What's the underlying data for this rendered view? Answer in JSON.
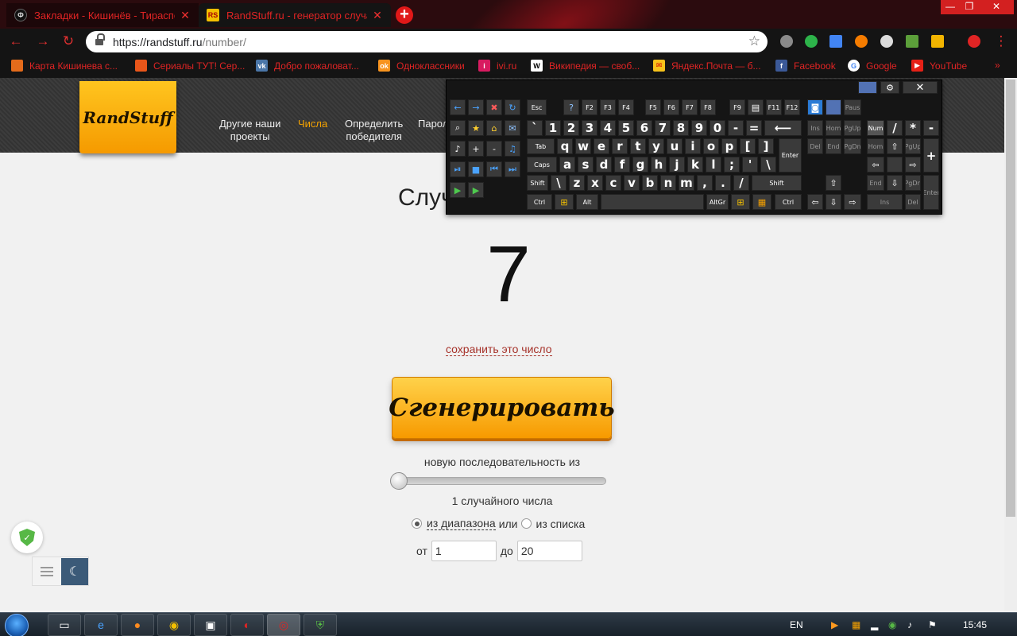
{
  "browser": {
    "tabs": [
      {
        "title": "Закладки - Кишинёв - Тирасполь",
        "active": false
      },
      {
        "title": "RandStuff.ru - генератор случайных чисел",
        "active": true
      }
    ],
    "address": {
      "host": "https://randstuff.ru",
      "path": "/number/"
    },
    "bookmarks": [
      {
        "label": "Карта Кишинева с...",
        "icon": "map-icon",
        "color": "#e36b1b"
      },
      {
        "label": "Сериалы ТУТ! Сер...",
        "icon": "flame-icon",
        "color": "#e9561a"
      },
      {
        "label": "Добро пожаловат...",
        "icon": "vk-icon",
        "color": "#4a76a8"
      },
      {
        "label": "Одноклассники",
        "icon": "ok-icon",
        "color": "#f7931e"
      },
      {
        "label": "ivi.ru",
        "icon": "ivi-icon",
        "color": "#d81b60"
      },
      {
        "label": "Википедия — своб...",
        "icon": "wikipedia-icon",
        "color": "#ffffff"
      },
      {
        "label": "Яндекс.Почта — б...",
        "icon": "mail-icon",
        "color": "#f6c21b"
      },
      {
        "label": "Facebook",
        "icon": "facebook-icon",
        "color": "#3b5998"
      },
      {
        "label": "Google",
        "icon": "google-icon",
        "color": "#ffffff"
      },
      {
        "label": "YouTube",
        "icon": "youtube-icon",
        "color": "#e62117"
      }
    ]
  },
  "site": {
    "logo": "RandStuff",
    "menu": [
      {
        "line1": "Другие наши",
        "line2": "проекты",
        "active": false
      },
      {
        "line1": "Числа",
        "line2": "",
        "active": true
      },
      {
        "line1": "Определить",
        "line2": "победителя",
        "active": false
      },
      {
        "line1": "Пароли",
        "line2": "",
        "active": false
      }
    ],
    "heading": "Случайное число",
    "result": "7",
    "save_link": "сохранить это число",
    "generate_button": "Сгенерировать",
    "sequence_label": "новую последовательность из",
    "slider_value": 1,
    "count_label": "1 случайного числа",
    "mode_range": "из диапазона",
    "mode_or": "или",
    "mode_list": "из списка",
    "from_label": "от",
    "from_value": "1",
    "to_label": "до",
    "to_value": "20"
  },
  "keyboard": {
    "row_number": [
      "`",
      "1",
      "2",
      "3",
      "4",
      "5",
      "6",
      "7",
      "8",
      "9",
      "0",
      "-",
      "="
    ],
    "row_q": [
      "q",
      "w",
      "e",
      "r",
      "t",
      "y",
      "u",
      "i",
      "o",
      "p",
      "[",
      "]"
    ],
    "row_a": [
      "a",
      "s",
      "d",
      "f",
      "g",
      "h",
      "j",
      "k",
      "l",
      ";",
      "'",
      "\\"
    ],
    "row_z": [
      "\\",
      "z",
      "x",
      "c",
      "v",
      "b",
      "n",
      "m",
      ",",
      ".",
      "/"
    ],
    "fkeys_1": [
      "F2",
      "F3",
      "F4"
    ],
    "fkeys_2": [
      "F5",
      "F6",
      "F7",
      "F8"
    ],
    "fkeys_3": [
      "F9",
      "F11",
      "F12"
    ],
    "labels": {
      "esc": "Esc",
      "tab": "Tab",
      "caps": "Caps",
      "shift": "Shift",
      "ctrl": "Ctrl",
      "alt": "Alt",
      "altgr": "AltGr",
      "enter": "Enter",
      "pause": "Paus",
      "ins": "Ins",
      "home": "Hom",
      "pgup": "PgUp",
      "del": "Del",
      "end": "End",
      "pgdn": "PgDn",
      "num": "Num",
      "numenter": "Enter",
      "slash": "/",
      "star": "*",
      "minus": "-",
      "plus": "+"
    }
  },
  "taskbar": {
    "language": "EN",
    "time": "15:45"
  }
}
